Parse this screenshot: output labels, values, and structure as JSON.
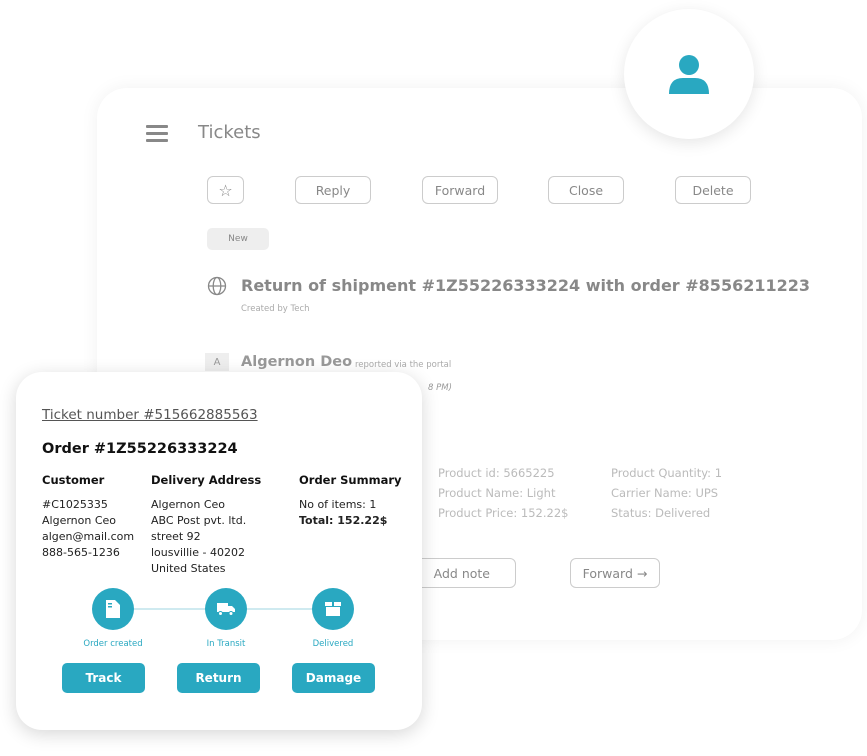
{
  "header": {
    "title": "Tickets"
  },
  "toolbar": {
    "reply": "Reply",
    "forward": "Forward",
    "close": "Close",
    "delete": "Delete"
  },
  "ticket": {
    "status": "New",
    "subject": "Return of shipment #1Z55226333224 with order #8556211223",
    "created_by": "Created by Tech",
    "author_initial": "A",
    "author": "Algernon Deo",
    "reported": "reported via the portal",
    "time_fragment": "8 PM)"
  },
  "product": {
    "left": [
      "Product id: 5665225",
      "Product Name: Light",
      "Product Price: 152.22$"
    ],
    "right": [
      "Product Quantity: 1",
      "Carrier Name: UPS",
      "Status: Delivered"
    ]
  },
  "actions": {
    "add_note": "Add note",
    "forward": "Forward →"
  },
  "card": {
    "ticket_number": "Ticket number #515662885563",
    "order": "Order #1Z55226333224",
    "customer": {
      "heading": "Customer",
      "lines": [
        "#C1025335",
        "Algernon Ceo",
        "algen@mail.com",
        "888-565-1236"
      ]
    },
    "address": {
      "heading": "Delivery Address",
      "lines": [
        "Algernon Ceo",
        "ABC Post pvt. ltd.",
        "street 92",
        "lousvillie - 40202",
        "United States"
      ]
    },
    "summary": {
      "heading": "Order Summary",
      "items": "No of items: 1",
      "total": "Total: 152.22$"
    },
    "steps": [
      {
        "label": "Order created",
        "icon": "document-icon"
      },
      {
        "label": "In Transit",
        "icon": "truck-icon"
      },
      {
        "label": "Delivered",
        "icon": "box-icon"
      }
    ],
    "buttons": {
      "track": "Track",
      "return": "Return",
      "damage": "Damage"
    }
  },
  "colors": {
    "accent": "#29a8c1"
  }
}
